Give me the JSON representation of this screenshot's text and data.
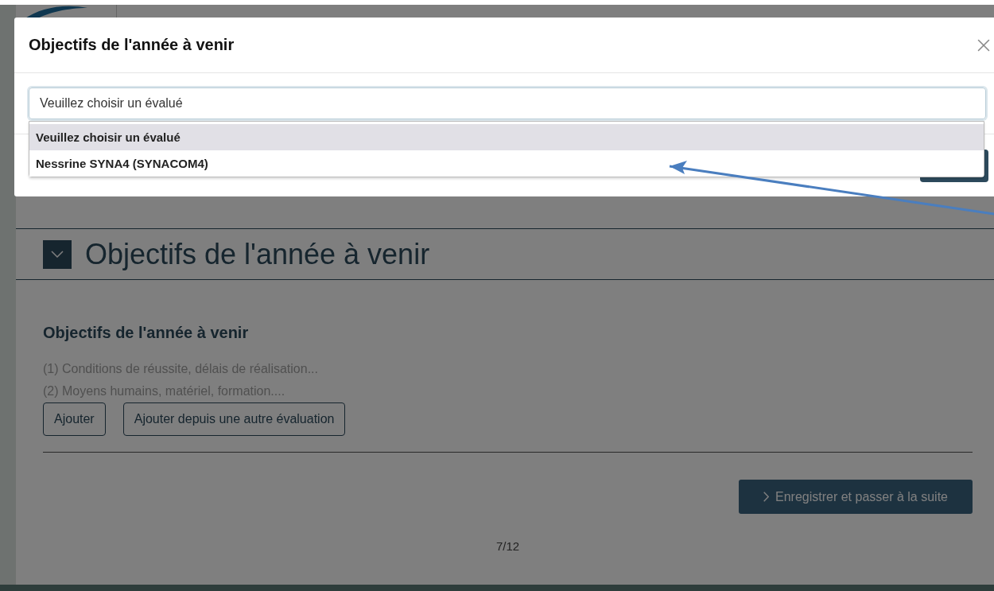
{
  "background_page": {
    "section": {
      "title": "Objectifs de l'année à venir",
      "expanded": true
    },
    "subtitle": "Objectifs de l'année à venir",
    "hints": [
      "(1) Conditions de réussite, délais de réalisation...",
      "(2) Moyens humains, matériel, formation...."
    ],
    "buttons": [
      "Ajouter",
      "Ajouter depuis une autre évaluation"
    ],
    "save_button": "Enregistrer et passer à la suite",
    "pagination": "7/12"
  },
  "modal": {
    "title": "Objectifs de l'année à venir",
    "select": {
      "value": "Veuillez choisir un évalué",
      "expanded": true,
      "options": [
        {
          "label": "Veuillez choisir un évalué",
          "selected": true
        },
        {
          "label": "Nessrine SYNA4 (SYNACOM4)",
          "selected": false
        }
      ]
    }
  }
}
